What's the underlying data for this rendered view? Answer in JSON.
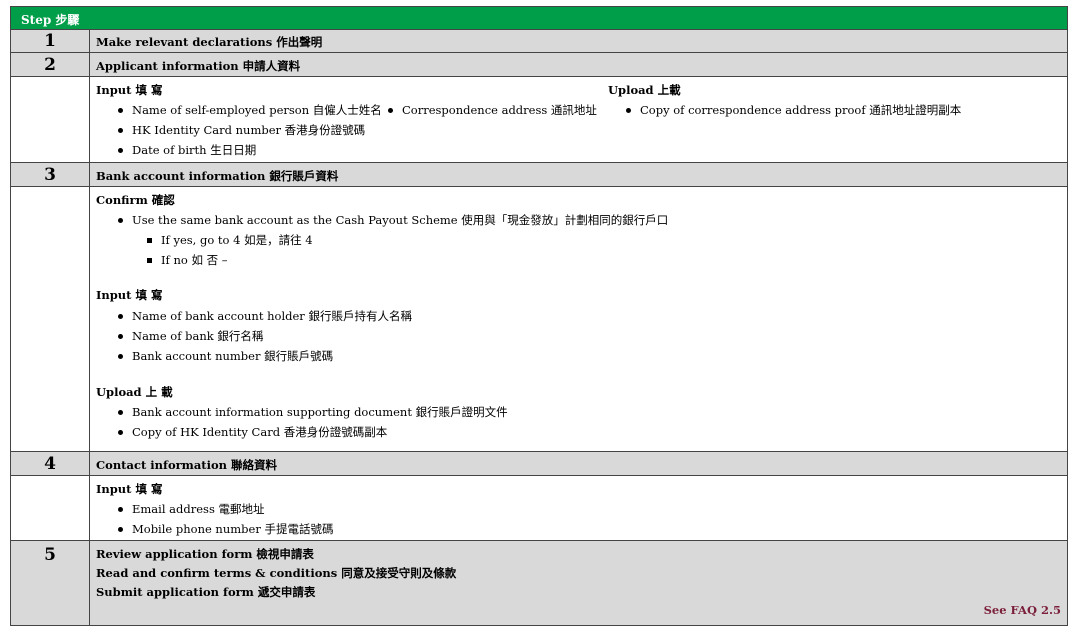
{
  "header": {
    "step_label": "Step 步驟"
  },
  "steps": [
    {
      "number": "1",
      "title": "Make relevant declarations  作出聲明"
    },
    {
      "number": "2",
      "title": "Applicant information 申請人資料"
    },
    {
      "number": "3",
      "title": "Bank account information  銀行賬戶資料"
    },
    {
      "number": "4",
      "title": "Contact information 聯絡資料"
    },
    {
      "number": "5",
      "lines": [
        "Review application form  檢視申請表",
        "Read and confirm terms & conditions 同意及接受守則及條款",
        "Submit application form  遞交申請表"
      ],
      "faq": "See FAQ 2.5"
    }
  ],
  "step2_detail": {
    "input_heading": "Input 填 寫",
    "input_items": [
      "Name of self-employed person  自僱人士姓名",
      "HK Identity Card number 香港身份證號碼",
      "Date of birth 生日日期"
    ],
    "input_items_col2": [
      "Correspondence address 通訊地址"
    ],
    "upload_heading": "Upload 上載",
    "upload_items": [
      "Copy of correspondence address proof 通訊地址證明副本"
    ]
  },
  "step3_detail": {
    "confirm_heading": "Confirm 確認",
    "confirm_item": "Use the same bank account as the Cash Payout Scheme 使用與「現金發放」計劃相同的銀行戶口",
    "sub_items": [
      "If yes, go to 4 如是，請往 4",
      "If no 如 否 –"
    ],
    "input_heading": "Input 填 寫",
    "input_items": [
      "Name of bank account holder  銀行賬戶持有人名稱",
      "Name of bank 銀行名稱",
      "Bank account number  銀行賬戶號碼"
    ],
    "upload_heading": "Upload 上 載",
    "upload_items": [
      "Bank account information supporting document 銀行賬戶證明文件",
      "Copy of HK Identity Card 香港身份證號碼副本"
    ]
  },
  "step4_detail": {
    "input_heading": "Input 填 寫",
    "input_items": [
      "Email address 電郵地址",
      "Mobile phone number 手提電話號碼"
    ]
  },
  "colors": {
    "header_green": "#009e49",
    "row_gray": "#d9d9d9",
    "faq_color": "#7b1e3a"
  }
}
